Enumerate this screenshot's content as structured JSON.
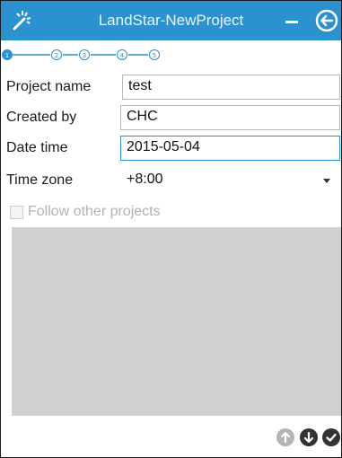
{
  "header": {
    "title": "LandStar-NewProject",
    "logo_icon": "magic-wand-icon",
    "minimize_icon": "minimize-icon",
    "back_icon": "back-arrow-icon",
    "background_color": "#2b92d0"
  },
  "steps": {
    "labels": [
      "1",
      "2",
      "3",
      "4",
      "5"
    ],
    "current": 1
  },
  "form": {
    "project_name": {
      "label": "Project name",
      "value": "test"
    },
    "created_by": {
      "label": "Created by",
      "value": "CHC"
    },
    "date_time": {
      "label": "Date time",
      "value": "2015-05-04"
    },
    "time_zone": {
      "label": "Time zone",
      "value": "+8:00"
    }
  },
  "follow": {
    "label": "Follow other projects",
    "checked": false
  },
  "toolbar": {
    "buttons": [
      "arrow-up-icon",
      "arrow-down-icon",
      "check-icon"
    ]
  }
}
